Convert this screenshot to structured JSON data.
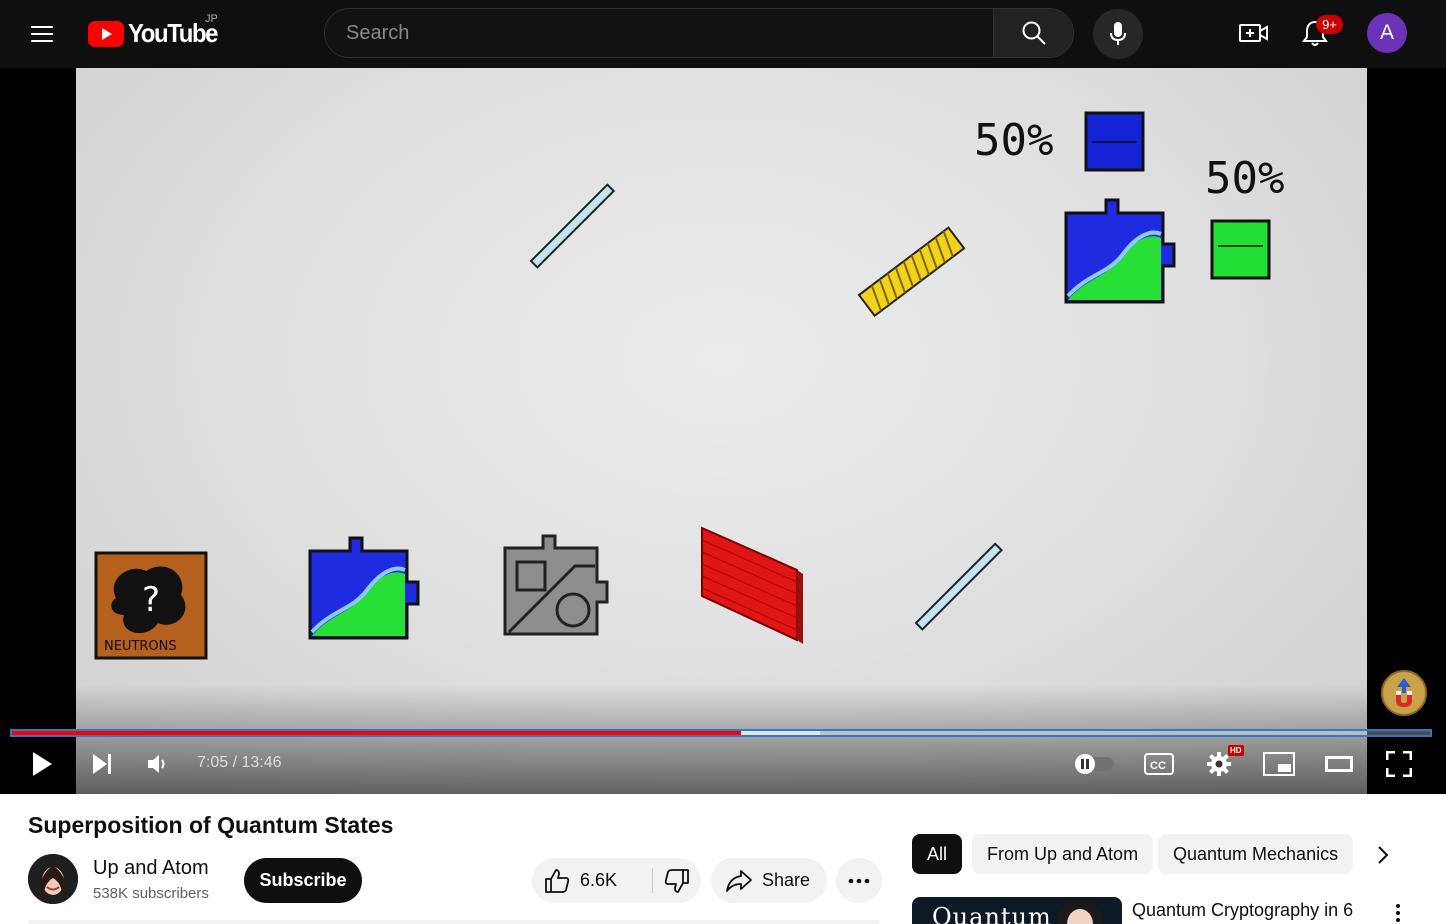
{
  "header": {
    "logo_text": "YouTube",
    "region": "JP",
    "search_placeholder": "Search",
    "notification_badge": "9+",
    "avatar_letter": "A"
  },
  "player": {
    "frame_labels": {
      "percent_top": "50%",
      "percent_right": "50%",
      "box_label": "NEUTRONS",
      "box_symbol": "?"
    },
    "current_time": "7:05",
    "separator": "/",
    "duration": "13:46",
    "played_fraction": 0.514,
    "buffered_fraction": 0.57,
    "settings_badge": "HD"
  },
  "video": {
    "title": "Superposition of Quantum States",
    "channel_name": "Up and Atom",
    "subscribers": "538K subscribers",
    "subscribe_label": "Subscribe",
    "like_count": "6.6K",
    "share_label": "Share"
  },
  "chips": [
    {
      "label": "All",
      "active": true
    },
    {
      "label": "From Up and Atom",
      "active": false
    },
    {
      "label": "Quantum Mechanics",
      "active": false
    }
  ],
  "recommendation": {
    "thumb_text": "Quantum",
    "title": "Quantum Cryptography in 6"
  },
  "colors": {
    "brand_red": "#ff0000",
    "progress_outline": "#2f79c9",
    "avatar_bg": "#6a33b8"
  },
  "icons": [
    "menu-icon",
    "youtube-logo-icon",
    "search-icon",
    "mic-icon",
    "create-video-icon",
    "bell-icon",
    "play-icon",
    "next-icon",
    "volume-icon",
    "autoplay-toggle-icon",
    "cc-icon",
    "settings-icon",
    "miniplayer-icon",
    "theater-icon",
    "fullscreen-icon",
    "like-icon",
    "dislike-icon",
    "share-icon",
    "more-icon",
    "chevron-right-icon",
    "kebab-icon"
  ]
}
